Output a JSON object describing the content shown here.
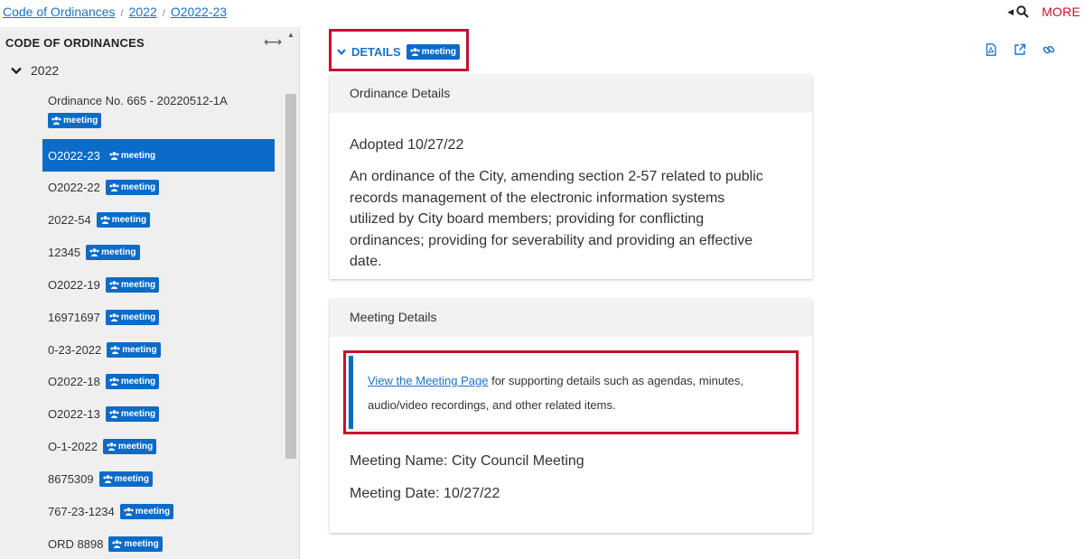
{
  "breadcrumb": {
    "items": [
      "Code of Ordinances",
      "2022",
      "O2022-23"
    ],
    "separator": "/"
  },
  "topbar": {
    "more_label": "MORE",
    "search_icon": "search-icon"
  },
  "sidebar": {
    "heading": "CODE OF ORDINANCES",
    "year": "2022",
    "badge_label": "meeting",
    "items": [
      {
        "label": "Ordinance No. 665 - 20220512-1A",
        "badge": "meeting"
      },
      {
        "label": "O2022-23",
        "badge": "meeting",
        "active": true
      },
      {
        "label": "O2022-22",
        "badge": "meeting"
      },
      {
        "label": "2022-54",
        "badge": "meeting"
      },
      {
        "label": "12345",
        "badge": "meeting"
      },
      {
        "label": "O2022-19",
        "badge": "meeting"
      },
      {
        "label": "16971697",
        "badge": "meeting"
      },
      {
        "label": "0-23-2022",
        "badge": "meeting"
      },
      {
        "label": "O2022-18",
        "badge": "meeting"
      },
      {
        "label": "O2022-13",
        "badge": "meeting"
      },
      {
        "label": "O-1-2022",
        "badge": "meeting"
      },
      {
        "label": "8675309",
        "badge": "meeting"
      },
      {
        "label": "767-23-1234",
        "badge": "meeting"
      },
      {
        "label": "ORD 8898",
        "badge": "meeting"
      }
    ]
  },
  "details": {
    "toggle_label": "DETAILS",
    "badge_label": "meeting"
  },
  "ordinance_card": {
    "title": "Ordinance Details",
    "adopted": "Adopted 10/27/22",
    "description": "An ordinance of the City, amending section 2-57 related to public records management of the electronic information systems utilized by City board members; providing for conflicting ordinances; providing for severability and providing an effective date."
  },
  "meeting_card": {
    "title": "Meeting Details",
    "link_text": "View the Meeting Page",
    "notice_text": " for supporting details such as agendas, minutes, audio/video recordings, and other related items.",
    "meeting_name": "Meeting Name: City Council Meeting",
    "meeting_date": "Meeting Date: 10/27/22"
  },
  "colors": {
    "accent": "#0a6bc8",
    "link": "#1a73c8",
    "highlight_border": "#c8102e"
  }
}
